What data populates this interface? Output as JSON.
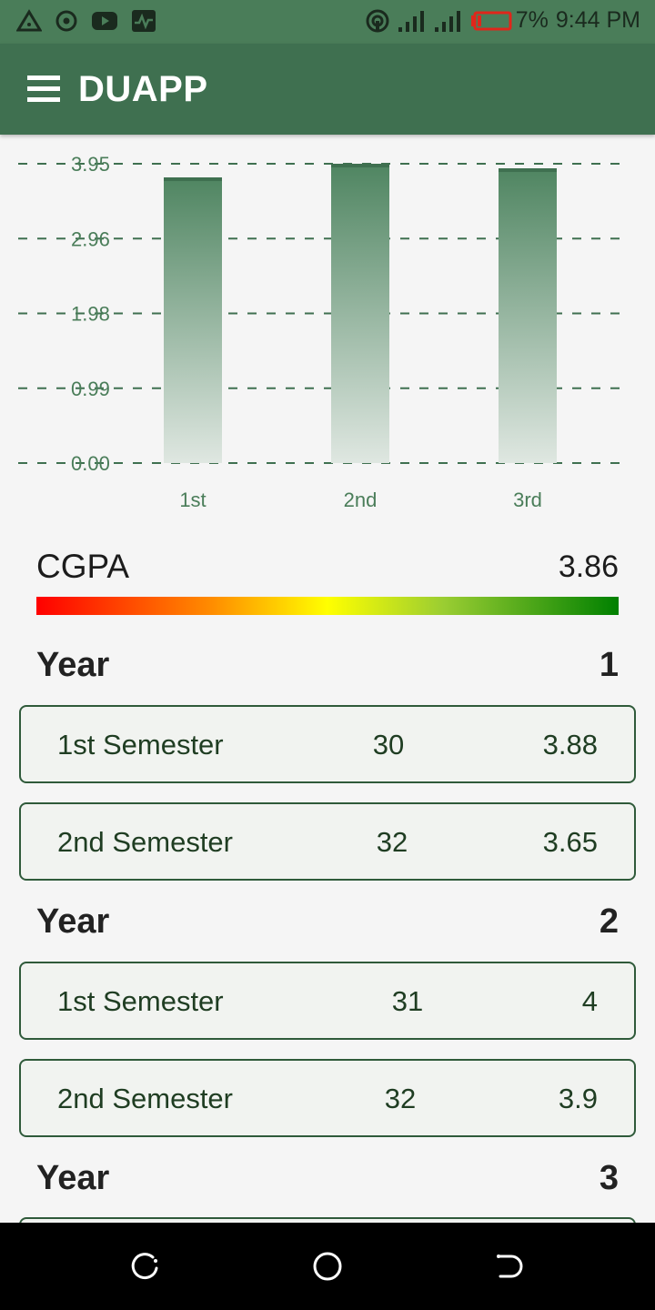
{
  "status_bar": {
    "battery": "7%",
    "time": "9:44 PM",
    "icons": [
      "alert-triangle-icon",
      "target-icon",
      "youtube-icon",
      "activity-icon",
      "hotspot-icon",
      "signal-icon",
      "signal-icon-2",
      "battery-low-icon"
    ],
    "battery_color": "#e0261b"
  },
  "app_bar": {
    "title": "DUAPP",
    "menu_icon": "hamburger-menu-icon",
    "color": "#3f7050"
  },
  "chart_data": {
    "type": "bar",
    "categories": [
      "1st",
      "2nd",
      "3rd"
    ],
    "values": [
      3.77,
      3.95,
      3.89
    ],
    "y_ticks": [
      "3.95",
      "2.96",
      "1.98",
      "0.99",
      "0.00"
    ],
    "ylim": [
      0,
      3.95
    ],
    "grid": true,
    "grid_style": "dashed",
    "bar_color": "#4a7d59"
  },
  "cgpa": {
    "label": "CGPA",
    "value": "3.86"
  },
  "years": [
    {
      "label": "Year",
      "number": "1",
      "semesters": [
        {
          "name": "1st Semester",
          "credits": "30",
          "gpa": "3.88"
        },
        {
          "name": "2nd Semester",
          "credits": "32",
          "gpa": "3.65"
        }
      ]
    },
    {
      "label": "Year",
      "number": "2",
      "semesters": [
        {
          "name": "1st Semester",
          "credits": "31",
          "gpa": "4"
        },
        {
          "name": "2nd Semester",
          "credits": "32",
          "gpa": "3.9"
        }
      ]
    },
    {
      "label": "Year",
      "number": "3",
      "semesters": []
    }
  ],
  "nav_bar": {
    "icons": [
      "recent-apps-icon",
      "home-icon",
      "back-icon"
    ]
  }
}
